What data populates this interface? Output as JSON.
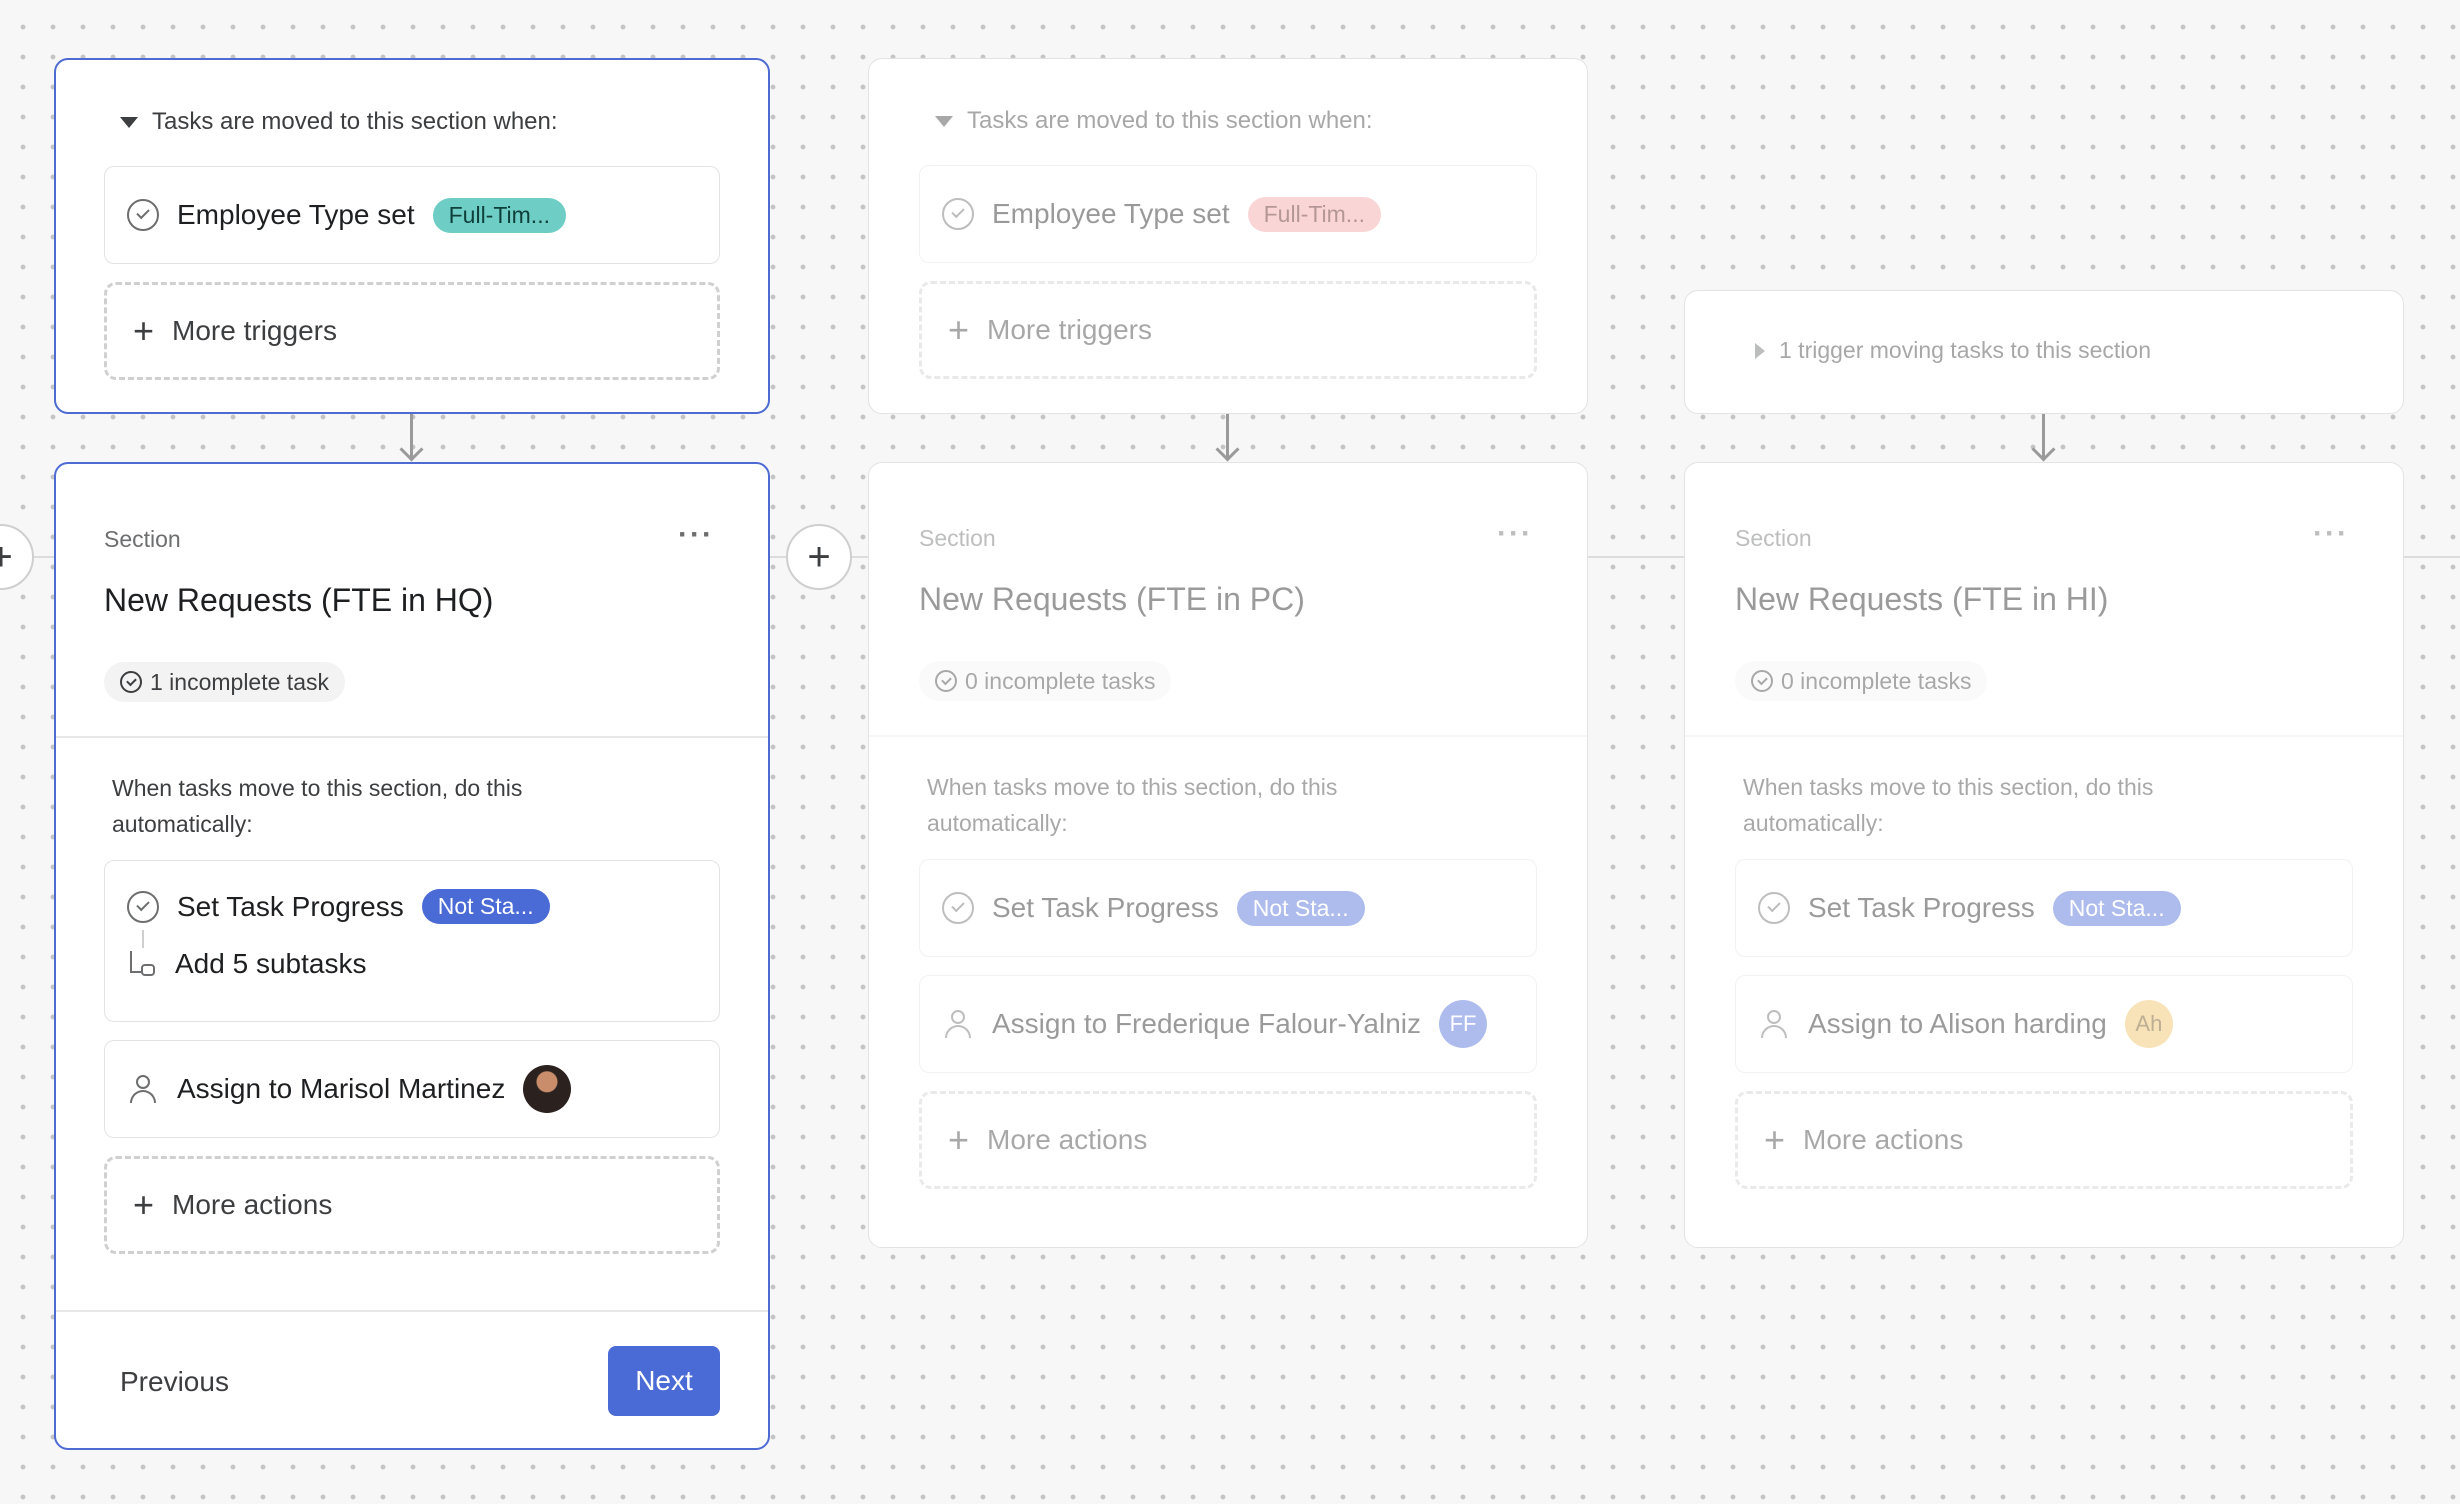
{
  "columns": [
    {
      "trigger": {
        "header": "Tasks are moved to this section when:",
        "rule_label": "Employee Type set",
        "rule_pill": "Full-Tim...",
        "more": "More triggers"
      },
      "section": {
        "label": "Section",
        "more": "···",
        "title": "New Requests (FTE in HQ)",
        "task_count": "1 incomplete task",
        "auto_text": "When tasks move to this section, do this automatically:",
        "actions": [
          {
            "label": "Set Task Progress",
            "pill": "Not Sta...",
            "sub": "Add 5 subtasks"
          },
          {
            "label": "Assign to Marisol Martinez"
          }
        ],
        "more_actions": "More actions",
        "previous": "Previous",
        "next": "Next"
      }
    },
    {
      "trigger": {
        "header": "Tasks are moved to this section when:",
        "rule_label": "Employee Type set",
        "rule_pill": "Full-Tim...",
        "more": "More triggers"
      },
      "section": {
        "label": "Section",
        "more": "···",
        "title": "New Requests (FTE in PC)",
        "task_count": "0 incomplete tasks",
        "auto_text": "When tasks move to this section, do this automatically:",
        "actions": [
          {
            "label": "Set Task Progress",
            "pill": "Not Sta..."
          },
          {
            "label": "Assign to Frederique Falour-Yalniz",
            "avatar": "FF"
          }
        ],
        "more_actions": "More actions"
      }
    },
    {
      "trigger": {
        "collapsed": "1 trigger moving tasks to this section"
      },
      "section": {
        "label": "Section",
        "more": "···",
        "title": "New Requests (FTE in HI)",
        "task_count": "0 incomplete tasks",
        "auto_text": "When tasks move to this section, do this automatically:",
        "actions": [
          {
            "label": "Set Task Progress",
            "pill": "Not Sta..."
          },
          {
            "label": "Assign to Alison harding",
            "avatar": "Ah"
          }
        ],
        "more_actions": "More actions"
      }
    }
  ],
  "add_section": "+",
  "colors": {
    "accent": "#4a6ad6",
    "pill_teal": "#6ecdc4",
    "pill_pink": "#f4a4a4",
    "pill_blue": "#4a6ad6",
    "avatar_ff": "#8da1e8",
    "avatar_ah": "#f6d9a4"
  }
}
